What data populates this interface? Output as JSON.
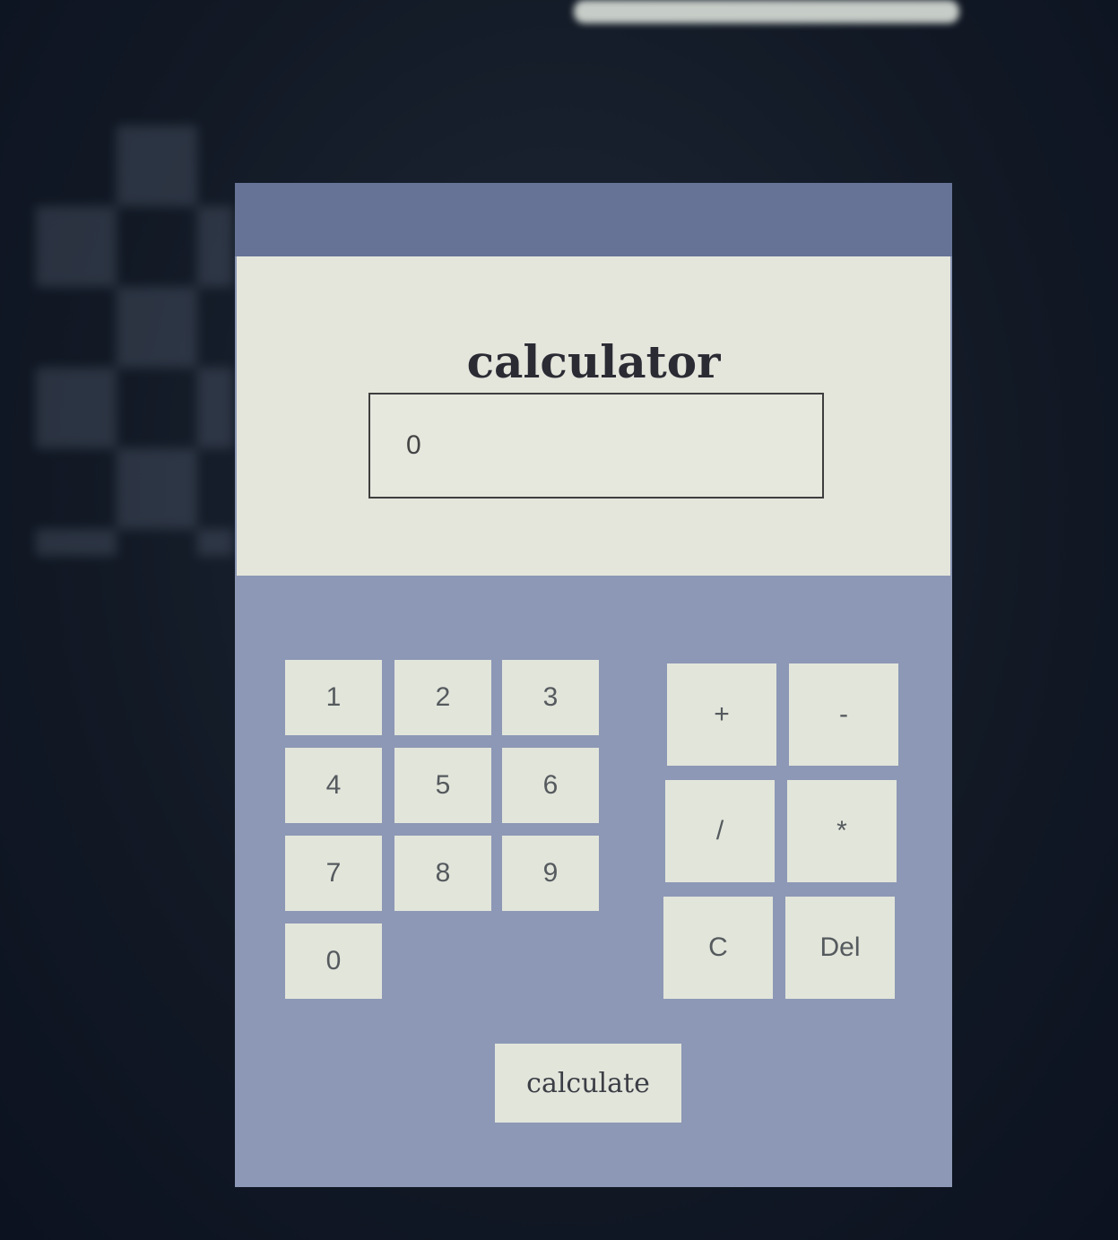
{
  "app": {
    "title": "calculator"
  },
  "display": {
    "value": "0"
  },
  "keypad": {
    "digits": [
      "1",
      "2",
      "3",
      "4",
      "5",
      "6",
      "7",
      "8",
      "9",
      "0"
    ],
    "operators": [
      "+",
      "-",
      "/",
      "*"
    ],
    "clear_label": "C",
    "delete_label": "Del",
    "calculate_label": "calculate"
  },
  "colors": {
    "window_bg": "#8d98b6",
    "titlebar": "#667397",
    "header_bg": "#e4e6dc",
    "button_bg": "#e2e5da",
    "title_text": "#2b2b34"
  }
}
